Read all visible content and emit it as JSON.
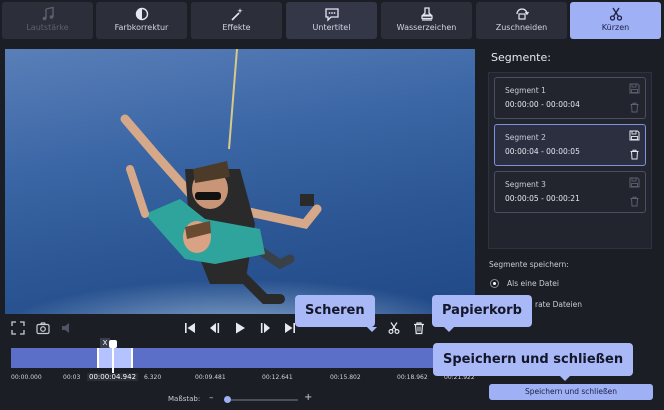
{
  "toolbar": {
    "tools": [
      {
        "label": "Lautstärke",
        "icon": "music-note-icon",
        "state": "disabled"
      },
      {
        "label": "Farbkorrektur",
        "icon": "color-correction-icon"
      },
      {
        "label": "Effekte",
        "icon": "magic-wand-icon"
      },
      {
        "label": "Untertitel",
        "icon": "speech-bubble-icon"
      },
      {
        "label": "Wasserzeichen",
        "icon": "stamp-icon"
      },
      {
        "label": "Zuschneiden",
        "icon": "crop-rotate-icon"
      },
      {
        "label": "Kürzen",
        "icon": "scissors-icon",
        "state": "active"
      }
    ]
  },
  "player": {
    "controls": [
      "fullscreen-icon",
      "snapshot-icon",
      "volume-icon",
      "skip-start-icon",
      "prev-frame-icon",
      "play-icon",
      "next-frame-icon",
      "skip-end-icon",
      "scissors-icon",
      "trash-icon"
    ]
  },
  "timeline": {
    "current_time": "00:00:04.942",
    "ticks": [
      "00:00.000",
      "00:03",
      "6.320",
      "00:09.481",
      "00:12.641",
      "00:15.802",
      "00:18.962",
      "00:21.922"
    ],
    "scale_label": "Maßstab:",
    "zoom_minus": "–",
    "zoom_plus": "+",
    "zoom_level": 0.05,
    "cut_marker": "X"
  },
  "segments_panel": {
    "title": "Segmente:",
    "segments": [
      {
        "name": "Segment 1",
        "time": "00:00:00 - 00:00:04"
      },
      {
        "name": "Segment 2",
        "time": "00:00:04 - 00:00:05",
        "selected": true
      },
      {
        "name": "Segment 3",
        "time": "00:00:05 - 00:00:21"
      }
    ],
    "save_header": "Segmente speichern:",
    "options": [
      {
        "label": "Als eine Datei",
        "checked": true
      },
      {
        "label": "rate Dateien",
        "checked": false
      }
    ],
    "save_close_button": "Speichern und schließen"
  },
  "tooltips": {
    "scissors": "Scheren",
    "trash": "Papierkorb",
    "save_close": "Speichern und schließen"
  },
  "colors": {
    "accent": "#9fb0f5",
    "background": "#1c1e26",
    "tooltip": "#a9b8f6"
  }
}
